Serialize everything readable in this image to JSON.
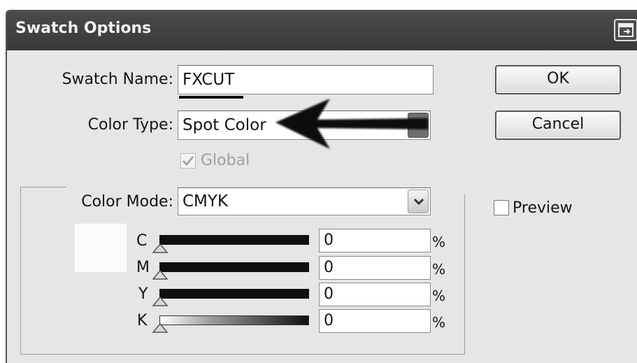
{
  "dialog": {
    "title": "Swatch Options",
    "swatch_name": {
      "label": "Swatch Name:",
      "value": "FXCUT"
    },
    "color_type": {
      "label": "Color Type:",
      "value": "Spot Color"
    },
    "global": {
      "label": "Global",
      "checked": true,
      "disabled": true
    },
    "color_mode": {
      "label": "Color Mode:",
      "value": "CMYK"
    },
    "buttons": {
      "ok": "OK",
      "cancel": "Cancel"
    },
    "preview": {
      "label": "Preview",
      "checked": false
    },
    "sliders": [
      {
        "label": "C",
        "value": "0",
        "unit": "%"
      },
      {
        "label": "M",
        "value": "0",
        "unit": "%"
      },
      {
        "label": "Y",
        "value": "0",
        "unit": "%"
      },
      {
        "label": "K",
        "value": "0",
        "unit": "%"
      }
    ],
    "swatch_preview_color": "#fbfbfb"
  },
  "icons": [
    "dialog-options-icon",
    "dropdown-arrow-icon",
    "checkmark-icon",
    "slider-thumb-icon",
    "annotation-arrow-icon"
  ]
}
